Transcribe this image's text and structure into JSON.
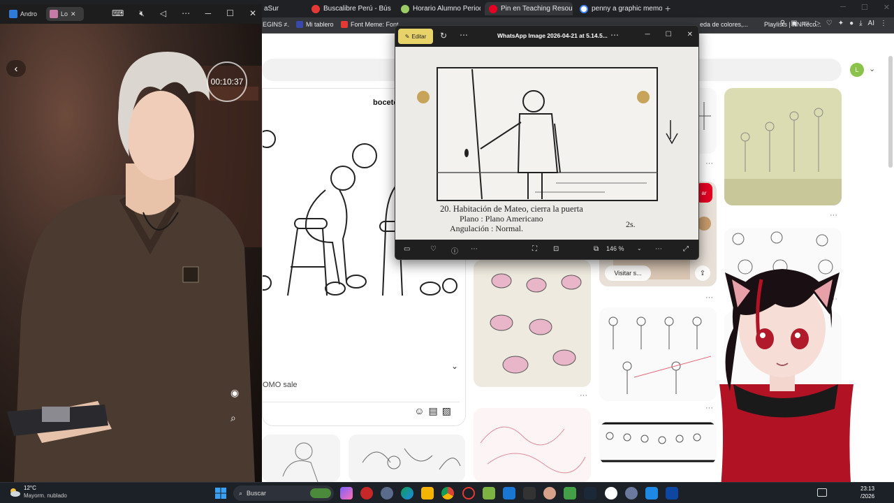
{
  "browser": {
    "tabs": [
      {
        "label": "aSur",
        "color": "#e0e0e0"
      },
      {
        "label": "Buscalibre Perú - Búsque",
        "color": "#e53935"
      },
      {
        "label": "Horario Alumno Periodo",
        "color": "#9ccc65"
      },
      {
        "label": "Pin en Teaching Resource",
        "color": "#e60023"
      },
      {
        "label": "penny a graphic memoir p",
        "color": "#ffffff"
      }
    ],
    "new_tab": "+",
    "bookmarks": [
      {
        "label": "EGINS ≠.",
        "color": "#777"
      },
      {
        "label": "Mi tablero",
        "color": "#3949ab"
      },
      {
        "label": "Font Meme: Font",
        "color": "#e53935"
      },
      {
        "label": "eda de colores,...",
        "color": "#777"
      },
      {
        "label": "Playlists | NNReco...",
        "color": "#777"
      }
    ],
    "extension_label": "AI",
    "avatar_letter": "L",
    "pin_title": "boceto",
    "promo_text": "OMO sale",
    "visit_label": "Visitar s...",
    "save_label": "ar"
  },
  "phone_window": {
    "tabs": [
      {
        "label": "Andro",
        "color": "#2f7bd8"
      },
      {
        "label": "Lo",
        "color": "#c77aa7"
      }
    ],
    "timer": "00:10:37"
  },
  "viewer": {
    "edit_label": "Editar",
    "title": "WhatsApp Image 2026-04-21 at 5.14.5...",
    "zoom": "146 %",
    "sketch_lines": [
      "20. Habitación de Mateo, cierra la puerta",
      "Plano : Plano Americano",
      "Angulación : Normal."
    ],
    "sketch_duration": "2s."
  },
  "taskbar": {
    "weather_temp": "12°C",
    "weather_desc": "Mayorm. nublado",
    "search_label": "Buscar",
    "time": "23:13",
    "date": "/2026"
  },
  "colors": {
    "pinterest_red": "#e60023",
    "edit_button": "#e8d36b",
    "taskbar": "#1c2027"
  },
  "icons": {
    "viewer_toolbar": [
      "filmstrip-icon",
      "heart-icon",
      "info-icon",
      "more-icon",
      "crop-icon",
      "ocr-icon",
      "fit-icon",
      "fullscreen-icon"
    ],
    "comment": [
      "emoji-icon",
      "sticker-icon",
      "image-icon"
    ]
  }
}
